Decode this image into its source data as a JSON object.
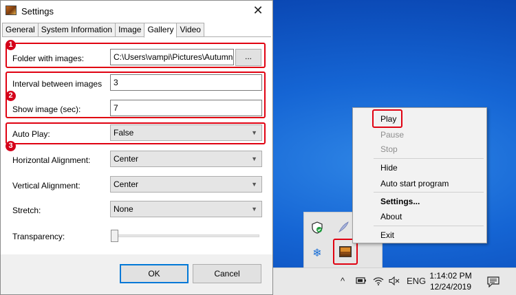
{
  "window": {
    "title": "Settings",
    "close_glyph": "✕",
    "tabs": [
      "General",
      "System Information",
      "Image",
      "Gallery",
      "Video"
    ],
    "active_tab": "Gallery"
  },
  "gallery": {
    "folder_label": "Folder with images:",
    "folder_value": "C:\\Users\\vampi\\Pictures\\Autumn",
    "browse_label": "...",
    "interval_label": "Interval between images",
    "interval_value": "3",
    "show_label": "Show image (sec):",
    "show_value": "7",
    "autoplay_label": "Auto Play:",
    "autoplay_value": "False",
    "halign_label": "Horizontal Alignment:",
    "halign_value": "Center",
    "valign_label": "Vertical Alignment:",
    "valign_value": "Center",
    "stretch_label": "Stretch:",
    "stretch_value": "None",
    "transparency_label": "Transparency:",
    "transparency_level": 0
  },
  "callouts": [
    "1",
    "2",
    "3"
  ],
  "buttons": {
    "ok": "OK",
    "cancel": "Cancel"
  },
  "context_menu": {
    "play": "Play",
    "pause": "Pause",
    "stop": "Stop",
    "hide": "Hide",
    "autostart": "Auto start program",
    "settings": "Settings...",
    "about": "About",
    "exit": "Exit"
  },
  "taskbar": {
    "chevron": "^",
    "language": "ENG",
    "time": "1:14:02 PM",
    "date": "12/24/2019"
  },
  "colors": {
    "highlight_red": "#e00010",
    "desktop_blue": "#1565d4",
    "default_button_border": "#0078d7"
  }
}
